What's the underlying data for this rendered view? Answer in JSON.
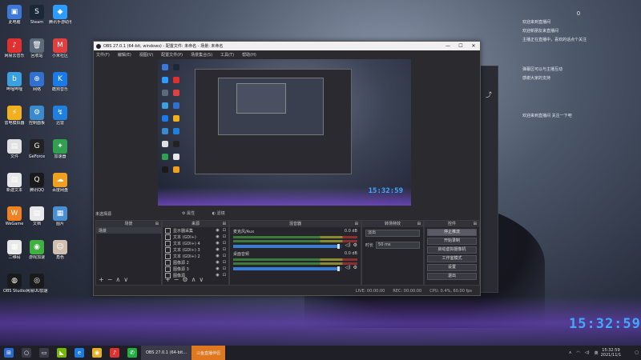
{
  "desktop_icons": [
    {
      "label": "此电脑",
      "color": "#3c78d8",
      "glyph": "▣"
    },
    {
      "label": "Steam",
      "color": "#1b2838",
      "glyph": "S"
    },
    {
      "label": "腾讯手游助手",
      "color": "#2e9cff",
      "glyph": "◆"
    },
    {
      "label": "网易云音乐",
      "color": "#e03030",
      "glyph": "♪"
    },
    {
      "label": "回收站",
      "color": "#5d6a7a",
      "glyph": "🗑"
    },
    {
      "label": "小米社区",
      "color": "#e04040",
      "glyph": "M"
    },
    {
      "label": "哔哩哔哩",
      "color": "#3aa0e0",
      "glyph": "b"
    },
    {
      "label": "网络",
      "color": "#3070d0",
      "glyph": "⊕"
    },
    {
      "label": "酷狗音乐",
      "color": "#1a7ae8",
      "glyph": "K"
    },
    {
      "label": "雷电模拟器",
      "color": "#f0b020",
      "glyph": "⚡"
    },
    {
      "label": "控制面板",
      "color": "#3a8ad0",
      "glyph": "⚙"
    },
    {
      "label": "迅雷",
      "color": "#2080e0",
      "glyph": "↯"
    },
    {
      "label": "文件",
      "color": "#e0e0e0",
      "glyph": "▤"
    },
    {
      "label": "GeForce",
      "color": "#222",
      "glyph": "G"
    },
    {
      "label": "加速器",
      "color": "#30a050",
      "glyph": "✦"
    },
    {
      "label": "新建文本",
      "color": "#e8e8e8",
      "glyph": "▤"
    },
    {
      "label": "腾讯QQ",
      "color": "#1a1a1a",
      "glyph": "Q"
    },
    {
      "label": "百度网盘",
      "color": "#f0a020",
      "glyph": "☁"
    },
    {
      "label": "WeGame",
      "color": "#f08020",
      "glyph": "W"
    },
    {
      "label": "文档",
      "color": "#e8e8e8",
      "glyph": "▤"
    },
    {
      "label": "图片",
      "color": "#4a90d0",
      "glyph": "▦"
    },
    {
      "label": "二维码",
      "color": "#e8e8e8",
      "glyph": "▦"
    },
    {
      "label": "游戏加速",
      "color": "#40b040",
      "glyph": "◉"
    },
    {
      "label": "角色",
      "color": "#d0c0b0",
      "glyph": "☺"
    },
    {
      "label": "OBS Studio",
      "color": "#1a1a1a",
      "glyph": "◍"
    },
    {
      "label": "网易UU加速",
      "color": "#1a1a1a",
      "glyph": "◎"
    }
  ],
  "right_panel": {
    "counter": "0",
    "lines": [
      "欢迎来到直播间",
      "欢迎新朋友来直播间",
      "主播正在直播中，喜欢的话点个关注",
      "弹幕区可以与主播互动",
      "感谢大家的支持",
      "欢迎来到直播间 关注一下吧"
    ]
  },
  "big_clock": "15:32:59",
  "obs": {
    "title": "OBS 27.0.1 (64-bit, windows) - 配置文件: 未命名 - 场景: 未命名",
    "menu": [
      "文件(F)",
      "编辑(E)",
      "视图(V)",
      "配置文件(P)",
      "场景集合(S)",
      "工具(T)",
      "帮助(H)"
    ],
    "preview_clock": "15:32:59",
    "scene_label": "未选择源",
    "preview_toolbar": [
      "属性",
      "滤镜"
    ],
    "scenes": {
      "header": "场景",
      "items": [
        "场景"
      ]
    },
    "sources": {
      "header": "来源",
      "items": [
        "显示器采集",
        "文本 (GDI+)",
        "文本 (GDI+) 4",
        "文本 (GDI+) 3",
        "文本 (GDI+) 2",
        "图像源 2",
        "图像源 3",
        "图像源"
      ]
    },
    "mixer": {
      "header": "混音器",
      "channels": [
        {
          "name": "麦克风/Aux",
          "db": "0.0 dB",
          "level": 0.97
        },
        {
          "name": "桌面音频",
          "db": "0.0 dB",
          "level": 0.97
        }
      ]
    },
    "transitions": {
      "header": "转场特效",
      "type": "淡出",
      "duration_label": "时长",
      "duration": "50 ms"
    },
    "controls": {
      "header": "控件",
      "buttons": [
        "停止推流",
        "开始录制",
        "启动虚拟摄像机",
        "工作室模式",
        "设置",
        "退出"
      ]
    },
    "status": [
      "LIVE: 00:00:00",
      "REC: 00:00:00",
      "CPU: 0.4%, 60.00 fps"
    ]
  },
  "taskbar": {
    "tasks": [
      {
        "label": "OBS 27.0.1 (64-bit...",
        "color": "#3a3a48"
      },
      {
        "label": "斗鱼直播伴侣",
        "color": "#e07820"
      }
    ],
    "tray_text": "英",
    "time": "15:32:59",
    "date": "2021/11/1"
  }
}
